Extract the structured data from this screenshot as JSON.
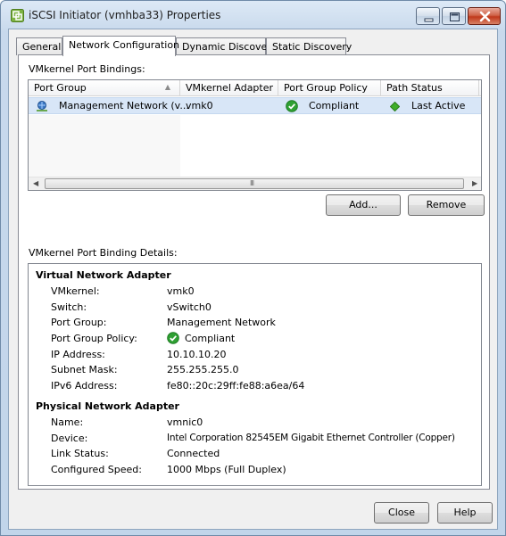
{
  "window": {
    "title": "iSCSI Initiator (vmhba33) Properties"
  },
  "tabs": [
    "General",
    "Network Configuration",
    "Dynamic Discovery",
    "Static Discovery"
  ],
  "bindings": {
    "section_label": "VMkernel Port Bindings:",
    "columns": [
      "Port Group",
      "VMkernel Adapter",
      "Port Group Policy",
      "Path Status"
    ],
    "rows": [
      {
        "port_group": "Management Network (v...",
        "vmkernel_adapter": "vmk0",
        "policy": "Compliant",
        "path_status": "Last Active"
      }
    ],
    "scroll_grip": "III",
    "add_label": "Add...",
    "remove_label": "Remove"
  },
  "details": {
    "section_label": "VMkernel Port Binding Details:",
    "virtual": {
      "title": "Virtual Network Adapter",
      "fields": [
        {
          "label": "VMkernel:",
          "value": "vmk0"
        },
        {
          "label": "Switch:",
          "value": "vSwitch0"
        },
        {
          "label": "Port Group:",
          "value": "Management Network"
        },
        {
          "label": "Port Group Policy:",
          "value": "Compliant"
        },
        {
          "label": "IP Address:",
          "value": "10.10.10.20"
        },
        {
          "label": "Subnet Mask:",
          "value": "255.255.255.0"
        },
        {
          "label": "IPv6 Address:",
          "value": "fe80::20c:29ff:fe88:a6ea/64"
        }
      ]
    },
    "physical": {
      "title": "Physical Network Adapter",
      "fields": [
        {
          "label": "Name:",
          "value": "vmnic0"
        },
        {
          "label": "Device:",
          "value": "Intel Corporation 82545EM Gigabit Ethernet Controller (Copper)"
        },
        {
          "label": "Link Status:",
          "value": "Connected"
        },
        {
          "label": "Configured Speed:",
          "value": "1000 Mbps (Full Duplex)"
        }
      ]
    }
  },
  "footer": {
    "close_label": "Close",
    "help_label": "Help"
  },
  "icons": {
    "app": "vmware-logo-icon",
    "network": "network-icon",
    "compliant": "green-check-icon",
    "path_active": "green-diamond-icon"
  },
  "colors": {
    "selection": "#d8e6f7",
    "check_green": "#2fa033",
    "diamond_green": "#3fae2a",
    "close_red": "#c0391b"
  }
}
